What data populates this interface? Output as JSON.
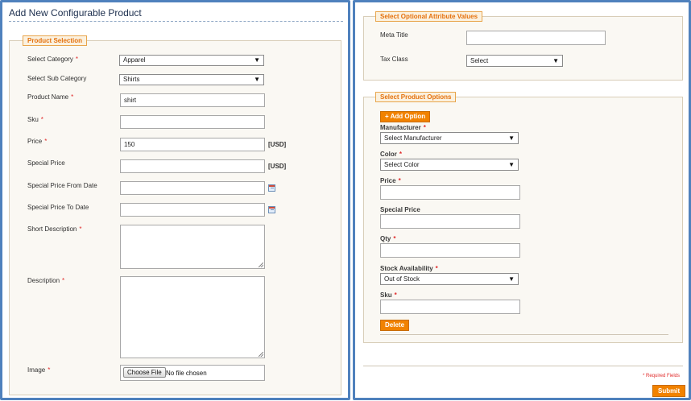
{
  "left": {
    "title": "Add New Configurable Product",
    "section_title": "Product Selection",
    "fields": {
      "category": {
        "label": "Select Category",
        "required": "*",
        "value": "Apparel"
      },
      "sub_category": {
        "label": "Select Sub Category",
        "value": "Shirts"
      },
      "product_name": {
        "label": "Product Name",
        "required": "*",
        "value": "shirt"
      },
      "sku": {
        "label": "Sku",
        "required": "*",
        "value": ""
      },
      "price": {
        "label": "Price",
        "required": "*",
        "value": "150",
        "unit": "[USD]"
      },
      "special_price": {
        "label": "Special Price",
        "value": "",
        "unit": "[USD]"
      },
      "special_from": {
        "label": "Special Price From Date",
        "value": ""
      },
      "special_to": {
        "label": "Special Price To Date",
        "value": ""
      },
      "short_description": {
        "label": "Short Description",
        "required": "*",
        "value": ""
      },
      "description": {
        "label": "Description",
        "required": "*",
        "value": ""
      },
      "image": {
        "label": "Image",
        "required": "*",
        "button": "Choose File",
        "status": "No file chosen"
      }
    }
  },
  "right": {
    "optional_title": "Select Optional Attribute Values",
    "meta_title": {
      "label": "Meta Title",
      "value": ""
    },
    "tax_class": {
      "label": "Tax Class",
      "value": "Select"
    },
    "options_title": "Select Product Options",
    "add_option": "+ Add Option",
    "manufacturer": {
      "label": "Manufacturer",
      "required": "*",
      "value": "Select Manufacturer"
    },
    "color": {
      "label": "Color",
      "required": "*",
      "value": "Select Color"
    },
    "price": {
      "label": "Price",
      "required": "*",
      "value": ""
    },
    "special_price": {
      "label": "Special Price",
      "value": ""
    },
    "qty": {
      "label": "Qty",
      "required": "*",
      "value": ""
    },
    "stock": {
      "label": "Stock Availability",
      "required": "*",
      "value": "Out of Stock"
    },
    "sku": {
      "label": "Sku",
      "required": "*",
      "value": ""
    },
    "delete": "Delete",
    "required_note": "* Required Fields",
    "submit": "Submit"
  },
  "icons": {
    "dropdown": "▼",
    "calendar": "calendar-icon"
  },
  "colors": {
    "accent": "#f18200",
    "border": "#4f81bd",
    "required": "#e02b2b"
  }
}
